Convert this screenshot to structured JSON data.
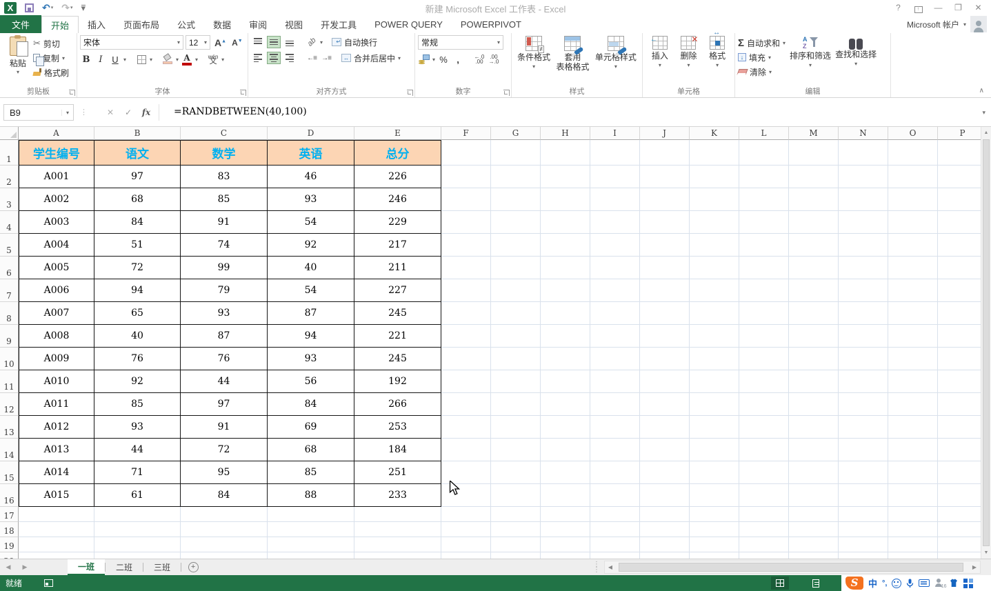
{
  "title_bar": {
    "title": "新建 Microsoft Excel 工作表 - Excel"
  },
  "ribbon_tabs": {
    "file_label": "文件",
    "tabs": [
      {
        "label": "开始",
        "active": true
      },
      {
        "label": "插入",
        "active": false
      },
      {
        "label": "页面布局",
        "active": false
      },
      {
        "label": "公式",
        "active": false
      },
      {
        "label": "数据",
        "active": false
      },
      {
        "label": "审阅",
        "active": false
      },
      {
        "label": "视图",
        "active": false
      },
      {
        "label": "开发工具",
        "active": false
      },
      {
        "label": "POWER QUERY",
        "active": false
      },
      {
        "label": "POWERPIVOT",
        "active": false
      }
    ],
    "account_label": "Microsoft 帐户"
  },
  "ribbon": {
    "clipboard": {
      "group_label": "剪贴板",
      "paste": "粘贴",
      "cut": "剪切",
      "copy": "复制",
      "format_painter": "格式刷"
    },
    "font": {
      "group_label": "字体",
      "font_name": "宋体",
      "font_size": "12",
      "bold": "B",
      "italic": "I",
      "underline": "U",
      "pinyin_top": "wén",
      "pinyin_bottom": "文"
    },
    "alignment": {
      "group_label": "对齐方式",
      "wrap_text": "自动换行",
      "merge_center": "合并后居中",
      "orientation": "ab",
      "indent_out": "←≡",
      "indent_in": "→≡"
    },
    "number": {
      "group_label": "数字",
      "format": "常规",
      "percent": "%",
      "comma": ",",
      "inc_dec": "←.0\n.00",
      "dec_dec": ".00\n→.0"
    },
    "styles": {
      "group_label": "样式",
      "conditional_formatting": "条件格式",
      "format_as_table": "套用\n表格格式",
      "cell_styles": "单元格样式"
    },
    "cells": {
      "group_label": "单元格",
      "insert": "插入",
      "delete": "删除",
      "format": "格式"
    },
    "editing": {
      "group_label": "编辑",
      "autosum": "自动求和",
      "fill": "填充",
      "clear": "清除",
      "sort_filter": "排序和筛选",
      "find_select": "查找和选择",
      "sigma": "Σ"
    },
    "collapse_icon": "∧"
  },
  "formula_bar": {
    "name_box": "B9",
    "formula": "=RANDBETWEEN(40,100)",
    "cancel_icon": "✕",
    "enter_icon": "✓",
    "fx_icon": "fx"
  },
  "grid": {
    "column_headers": [
      "A",
      "B",
      "C",
      "D",
      "E",
      "F",
      "G",
      "H",
      "I",
      "J",
      "K",
      "L",
      "M",
      "N",
      "O",
      "P"
    ],
    "row_count": 20
  },
  "table": {
    "headers": [
      "学生编号",
      "语文",
      "数学",
      "英语",
      "总分"
    ],
    "rows": [
      [
        "A001",
        "97",
        "83",
        "46",
        "226"
      ],
      [
        "A002",
        "68",
        "85",
        "93",
        "246"
      ],
      [
        "A003",
        "84",
        "91",
        "54",
        "229"
      ],
      [
        "A004",
        "51",
        "74",
        "92",
        "217"
      ],
      [
        "A005",
        "72",
        "99",
        "40",
        "211"
      ],
      [
        "A006",
        "94",
        "79",
        "54",
        "227"
      ],
      [
        "A007",
        "65",
        "93",
        "87",
        "245"
      ],
      [
        "A008",
        "40",
        "87",
        "94",
        "221"
      ],
      [
        "A009",
        "76",
        "76",
        "93",
        "245"
      ],
      [
        "A010",
        "92",
        "44",
        "56",
        "192"
      ],
      [
        "A011",
        "85",
        "97",
        "84",
        "266"
      ],
      [
        "A012",
        "93",
        "91",
        "69",
        "253"
      ],
      [
        "A013",
        "44",
        "72",
        "68",
        "184"
      ],
      [
        "A014",
        "71",
        "95",
        "85",
        "251"
      ],
      [
        "A015",
        "61",
        "84",
        "88",
        "233"
      ]
    ],
    "header_fill": "#fcd5b4",
    "header_text_color": "#00b0f0"
  },
  "sheet_bar": {
    "tabs": [
      {
        "label": "一班",
        "active": true
      },
      {
        "label": "二班",
        "active": false
      },
      {
        "label": "三班",
        "active": false
      }
    ],
    "add_sheet_icon": "+"
  },
  "status_bar": {
    "ready_label": "就绪"
  },
  "ime_tray": {
    "mode_label": "中",
    "punct_label": "°,",
    "person_badge": "16"
  },
  "icons": {
    "dropdown": "▾",
    "help": "?",
    "minimize": "—",
    "restore": "❐",
    "close": "✕",
    "undo": "↶",
    "redo": "↷",
    "scroll_up": "▲",
    "scroll_down": "▼",
    "scroll_left": "◀",
    "scroll_right": "▶",
    "nav_left": "◀",
    "nav_right": "▶",
    "dots": "⋮",
    "grip": "⋮⋮",
    "excel_logo": "X"
  },
  "colors": {
    "excel_green": "#217346",
    "header_fill": "#fcd5b4",
    "header_text": "#00b0f0"
  }
}
